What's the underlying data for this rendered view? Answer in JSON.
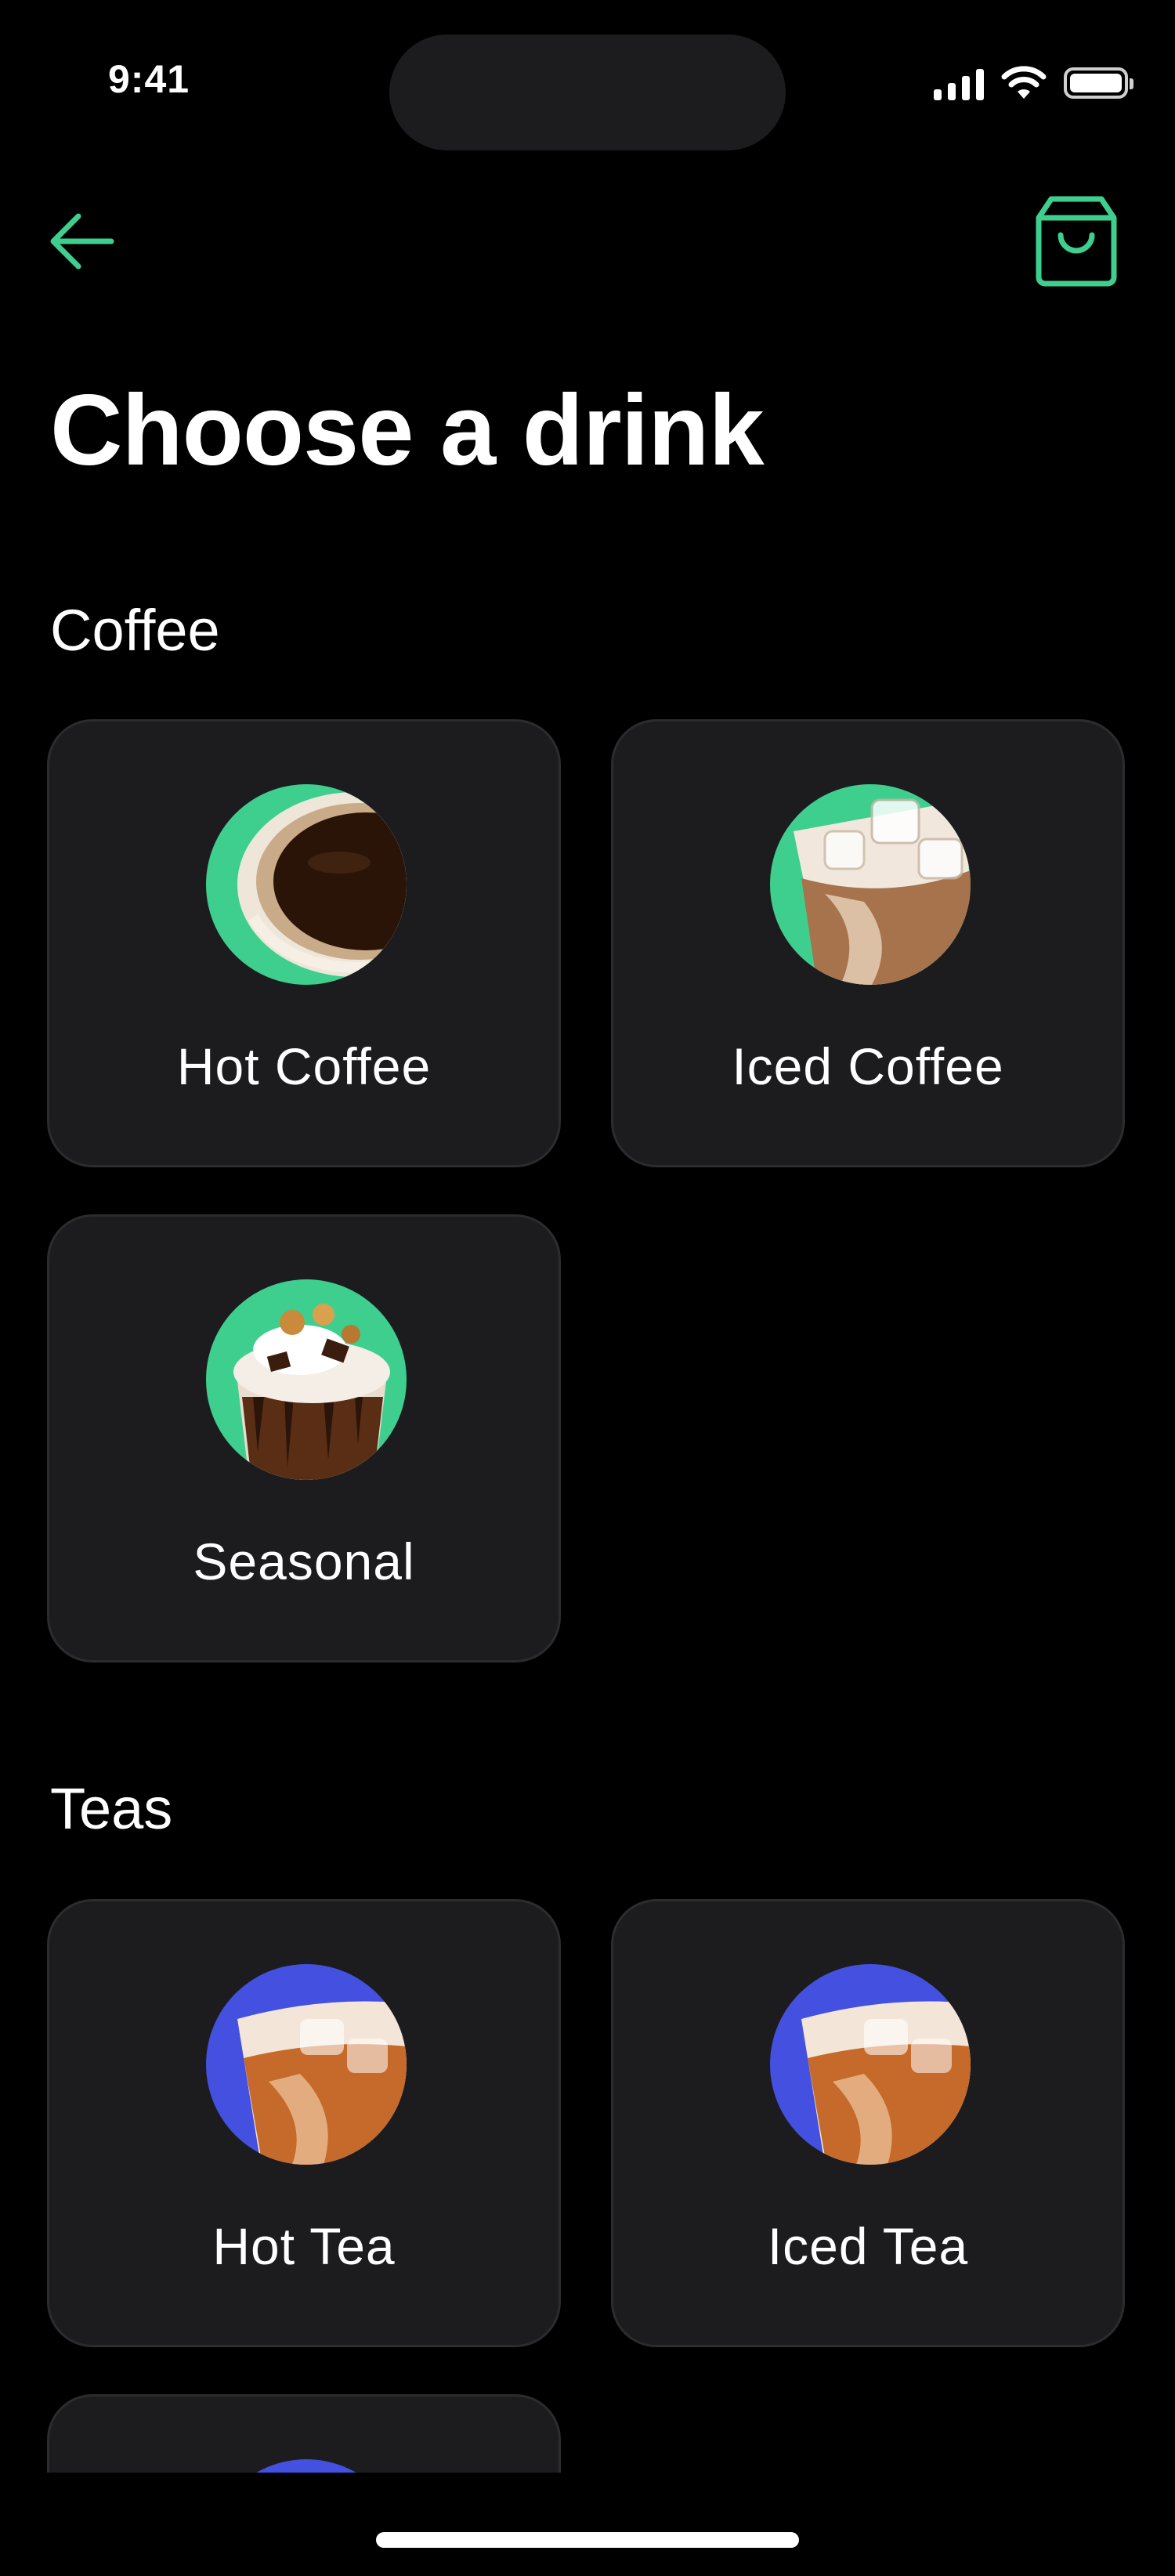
{
  "status_bar": {
    "time": "9:41"
  },
  "header": {
    "title": "Choose a drink"
  },
  "colors": {
    "accent": "#3ecf8e",
    "coffee_circle": "#3ecf8e",
    "tea_circle": "#4350e0",
    "card_bg": "#1c1c1e"
  },
  "icons": {
    "back": "arrow-left-icon",
    "cart": "shopping-bag-icon"
  },
  "sections": [
    {
      "title": "Coffee",
      "items": [
        {
          "label": "Hot Coffee",
          "image": "hot-coffee-image"
        },
        {
          "label": "Iced Coffee",
          "image": "iced-coffee-image"
        },
        {
          "label": "Seasonal",
          "image": "seasonal-drink-image"
        }
      ]
    },
    {
      "title": "Teas",
      "items": [
        {
          "label": "Hot Tea",
          "image": "hot-tea-image"
        },
        {
          "label": "Iced Tea",
          "image": "iced-tea-image"
        }
      ]
    }
  ]
}
